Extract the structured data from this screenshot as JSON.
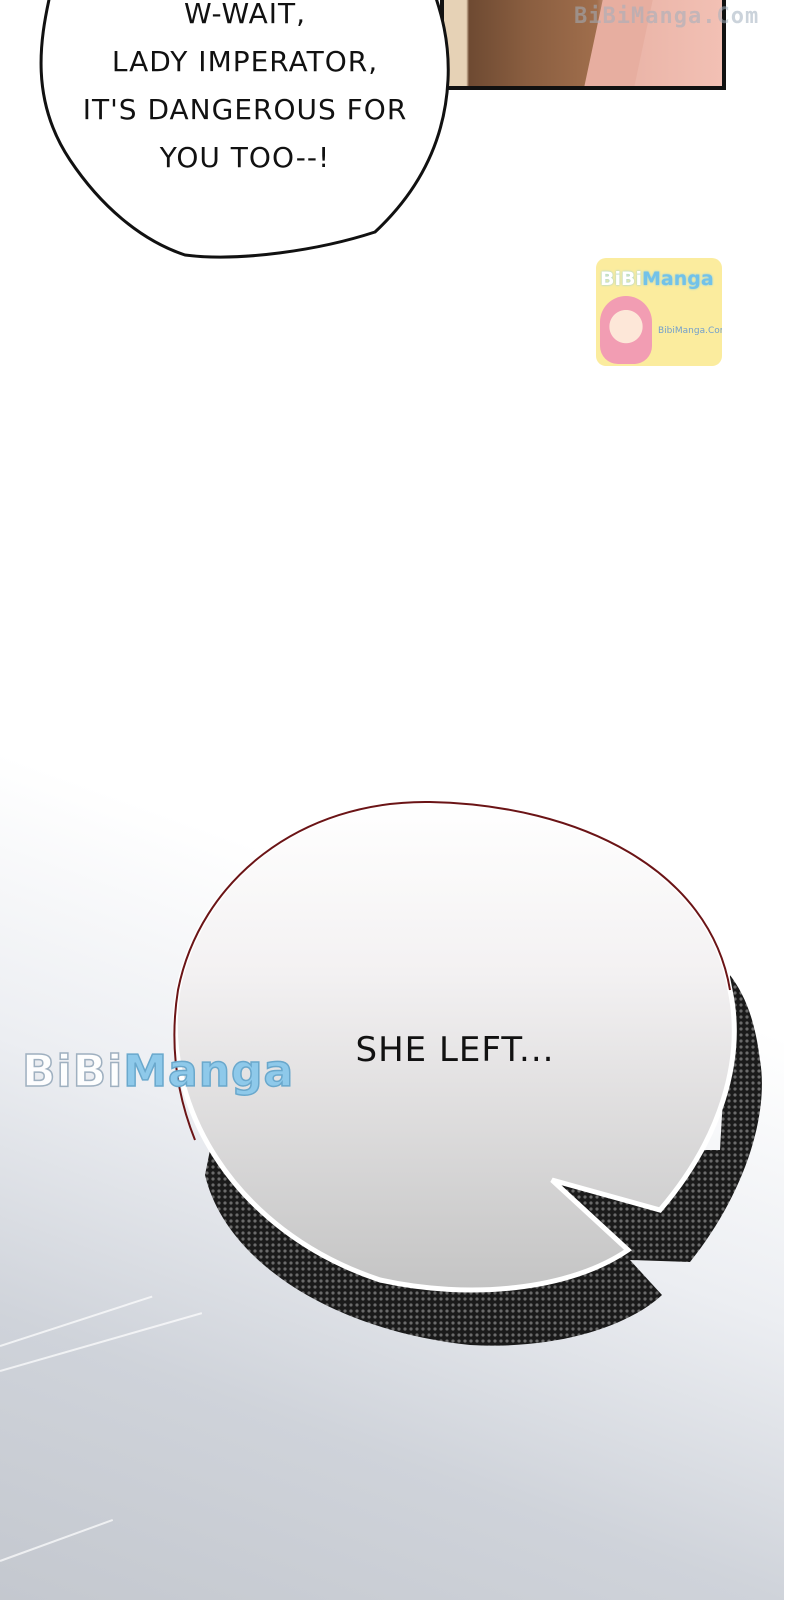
{
  "speech_bubble": {
    "lines": [
      "W-WAIT,",
      "LADY IMPERATOR,",
      "IT'S DANGEROUS FOR",
      "YOU TOO--!"
    ]
  },
  "thought_bubble": {
    "text": "SHE LEFT..."
  },
  "watermarks": {
    "top": "BiBiManga.Com",
    "logo_brand_a": "BiBi",
    "logo_brand_b": "Manga",
    "logo_url": "BibiManga.Com",
    "middle_a": "BiBi",
    "middle_b": "Manga"
  }
}
